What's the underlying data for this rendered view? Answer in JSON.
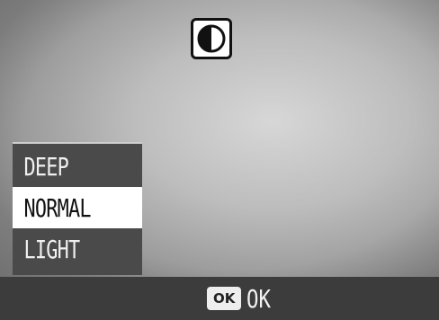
{
  "header": {
    "icon": "contrast-icon"
  },
  "menu": {
    "items": [
      {
        "label": "DEEP",
        "selected": false
      },
      {
        "label": "NORMAL",
        "selected": true
      },
      {
        "label": "LIGHT",
        "selected": false
      }
    ]
  },
  "footer": {
    "ok_badge": "OK",
    "ok_label": "OK"
  },
  "colors": {
    "menu_bg": "#4a4a4a",
    "menu_selected_bg": "#ffffff",
    "bar_bg": "#3c3c3c"
  }
}
